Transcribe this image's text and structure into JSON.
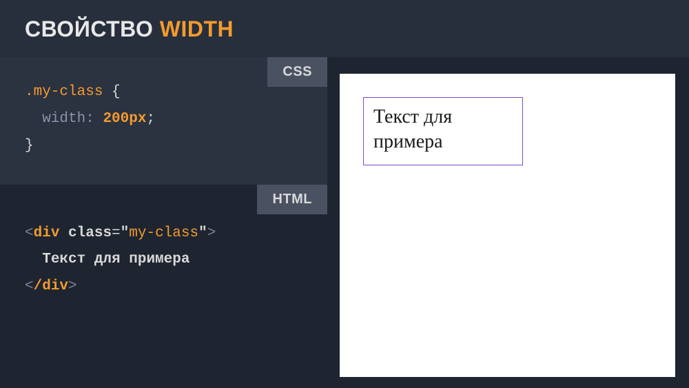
{
  "title": {
    "prefix": "СВОЙСТВО ",
    "highlight": "WIDTH"
  },
  "labels": {
    "css": "CSS",
    "html": "HTML"
  },
  "css_code": {
    "selector": ".my-class",
    "open": " {",
    "indent": "  ",
    "prop": "width",
    "colon": ": ",
    "value": "200px",
    "semi": ";",
    "close": "}"
  },
  "html_code": {
    "lt": "<",
    "tag": "div",
    "space": " ",
    "attr": "class",
    "eq": "=",
    "quote": "\"",
    "strval": "my-class",
    "gt": ">",
    "indent": "  ",
    "text": "Текст для примера",
    "slash": "/"
  },
  "preview": {
    "text": "Текст для примера"
  }
}
